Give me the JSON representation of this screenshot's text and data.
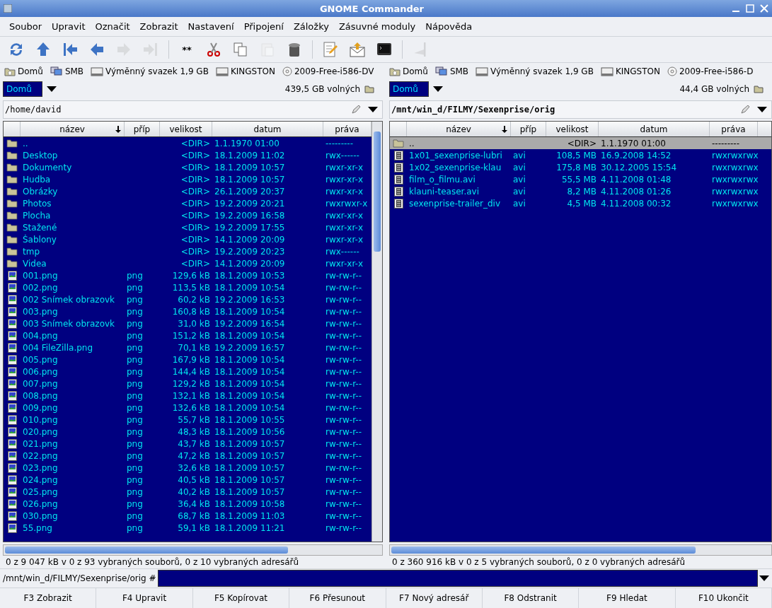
{
  "window": {
    "title": "GNOME Commander"
  },
  "menu": [
    "Soubor",
    "Upravit",
    "Označit",
    "Zobrazit",
    "Nastavení",
    "Připojení",
    "Záložky",
    "Zásuvné moduly",
    "Nápověda"
  ],
  "toolbar": [
    {
      "kind": "refresh",
      "disabled": false
    },
    {
      "kind": "up",
      "disabled": false
    },
    {
      "kind": "first",
      "disabled": false
    },
    {
      "kind": "back",
      "disabled": false
    },
    {
      "kind": "forward",
      "disabled": true
    },
    {
      "kind": "last",
      "disabled": true
    },
    {
      "kind": "separator"
    },
    {
      "kind": "pattern",
      "label": "**",
      "disabled": false
    },
    {
      "kind": "cut",
      "disabled": false
    },
    {
      "kind": "copy",
      "disabled": false
    },
    {
      "kind": "paste",
      "disabled": true
    },
    {
      "kind": "trash",
      "disabled": false
    },
    {
      "kind": "separator"
    },
    {
      "kind": "edit",
      "disabled": false
    },
    {
      "kind": "mail",
      "disabled": false
    },
    {
      "kind": "terminal",
      "disabled": false
    },
    {
      "kind": "separator"
    },
    {
      "kind": "disconnect",
      "disabled": true
    }
  ],
  "panels": [
    {
      "active": false,
      "devices": [
        {
          "kind": "home",
          "label": "Domů"
        },
        {
          "kind": "network",
          "label": "SMB"
        },
        {
          "kind": "drive",
          "label": "Výměnný svazek 1,9 GB"
        },
        {
          "kind": "drive",
          "label": "KINGSTON"
        },
        {
          "kind": "disc",
          "label": "2009-Free-i586-DV"
        }
      ],
      "device_combo": "Domů",
      "free_space": "439,5 GB volných",
      "path": "/home/david",
      "columns": [
        "název",
        "příp",
        "velikost",
        "datum",
        "práva"
      ],
      "rows": [
        {
          "kind": "folder",
          "selected": false,
          "name": "..",
          "ext": "",
          "size": "<DIR>",
          "date": "1.1.1970 01:00",
          "perms": "---------"
        },
        {
          "kind": "folder",
          "selected": false,
          "name": "Desktop",
          "ext": "",
          "size": "<DIR>",
          "date": "18.1.2009 11:02",
          "perms": "rwx------"
        },
        {
          "kind": "folder",
          "selected": false,
          "name": "Dokumenty",
          "ext": "",
          "size": "<DIR>",
          "date": "18.1.2009 10:57",
          "perms": "rwxr-xr-x"
        },
        {
          "kind": "folder",
          "selected": false,
          "name": "Hudba",
          "ext": "",
          "size": "<DIR>",
          "date": "18.1.2009 10:57",
          "perms": "rwxr-xr-x"
        },
        {
          "kind": "folder",
          "selected": false,
          "name": "Obrázky",
          "ext": "",
          "size": "<DIR>",
          "date": "26.1.2009 20:37",
          "perms": "rwxr-xr-x"
        },
        {
          "kind": "folder",
          "selected": false,
          "name": "Photos",
          "ext": "",
          "size": "<DIR>",
          "date": "19.2.2009 20:21",
          "perms": "rwxrwxr-x"
        },
        {
          "kind": "folder",
          "selected": false,
          "name": "Plocha",
          "ext": "",
          "size": "<DIR>",
          "date": "19.2.2009 16:58",
          "perms": "rwxr-xr-x"
        },
        {
          "kind": "folder",
          "selected": false,
          "name": "Stažené",
          "ext": "",
          "size": "<DIR>",
          "date": "19.2.2009 17:55",
          "perms": "rwxr-xr-x"
        },
        {
          "kind": "folder",
          "selected": false,
          "name": "Šablony",
          "ext": "",
          "size": "<DIR>",
          "date": "14.1.2009 20:09",
          "perms": "rwxr-xr-x"
        },
        {
          "kind": "folder",
          "selected": false,
          "name": "tmp",
          "ext": "",
          "size": "<DIR>",
          "date": "19.2.2009 20:23",
          "perms": "rwx------"
        },
        {
          "kind": "folder",
          "selected": false,
          "name": "Videa",
          "ext": "",
          "size": "<DIR>",
          "date": "14.1.2009 20:09",
          "perms": "rwxr-xr-x"
        },
        {
          "kind": "image",
          "selected": false,
          "name": "001.png",
          "ext": "png",
          "size": "129,6 kB",
          "date": "18.1.2009 10:53",
          "perms": "rw-rw-r--"
        },
        {
          "kind": "image",
          "selected": false,
          "name": "002.png",
          "ext": "png",
          "size": "113,5 kB",
          "date": "18.1.2009 10:54",
          "perms": "rw-rw-r--"
        },
        {
          "kind": "image",
          "selected": false,
          "name": "002 Snímek obrazovk",
          "ext": "png",
          "size": "60,2 kB",
          "date": "19.2.2009 16:53",
          "perms": "rw-rw-r--"
        },
        {
          "kind": "image",
          "selected": false,
          "name": "003.png",
          "ext": "png",
          "size": "160,8 kB",
          "date": "18.1.2009 10:54",
          "perms": "rw-rw-r--"
        },
        {
          "kind": "image",
          "selected": false,
          "name": "003 Snímek obrazovk",
          "ext": "png",
          "size": "31,0 kB",
          "date": "19.2.2009 16:54",
          "perms": "rw-rw-r--"
        },
        {
          "kind": "image",
          "selected": false,
          "name": "004.png",
          "ext": "png",
          "size": "151,2 kB",
          "date": "18.1.2009 10:54",
          "perms": "rw-rw-r--"
        },
        {
          "kind": "image",
          "selected": false,
          "name": "004 FileZilla.png",
          "ext": "png",
          "size": "70,1 kB",
          "date": "19.2.2009 16:57",
          "perms": "rw-rw-r--"
        },
        {
          "kind": "image",
          "selected": false,
          "name": "005.png",
          "ext": "png",
          "size": "167,9 kB",
          "date": "18.1.2009 10:54",
          "perms": "rw-rw-r--"
        },
        {
          "kind": "image",
          "selected": false,
          "name": "006.png",
          "ext": "png",
          "size": "144,4 kB",
          "date": "18.1.2009 10:54",
          "perms": "rw-rw-r--"
        },
        {
          "kind": "image",
          "selected": false,
          "name": "007.png",
          "ext": "png",
          "size": "129,2 kB",
          "date": "18.1.2009 10:54",
          "perms": "rw-rw-r--"
        },
        {
          "kind": "image",
          "selected": false,
          "name": "008.png",
          "ext": "png",
          "size": "132,1 kB",
          "date": "18.1.2009 10:54",
          "perms": "rw-rw-r--"
        },
        {
          "kind": "image",
          "selected": false,
          "name": "009.png",
          "ext": "png",
          "size": "132,6 kB",
          "date": "18.1.2009 10:54",
          "perms": "rw-rw-r--"
        },
        {
          "kind": "image",
          "selected": false,
          "name": "010.png",
          "ext": "png",
          "size": "55,7 kB",
          "date": "18.1.2009 10:55",
          "perms": "rw-rw-r--"
        },
        {
          "kind": "image",
          "selected": false,
          "name": "020.png",
          "ext": "png",
          "size": "48,3 kB",
          "date": "18.1.2009 10:56",
          "perms": "rw-rw-r--"
        },
        {
          "kind": "image",
          "selected": false,
          "name": "021.png",
          "ext": "png",
          "size": "43,7 kB",
          "date": "18.1.2009 10:57",
          "perms": "rw-rw-r--"
        },
        {
          "kind": "image",
          "selected": false,
          "name": "022.png",
          "ext": "png",
          "size": "47,2 kB",
          "date": "18.1.2009 10:57",
          "perms": "rw-rw-r--"
        },
        {
          "kind": "image",
          "selected": false,
          "name": "023.png",
          "ext": "png",
          "size": "32,6 kB",
          "date": "18.1.2009 10:57",
          "perms": "rw-rw-r--"
        },
        {
          "kind": "image",
          "selected": false,
          "name": "024.png",
          "ext": "png",
          "size": "40,5 kB",
          "date": "18.1.2009 10:57",
          "perms": "rw-rw-r--"
        },
        {
          "kind": "image",
          "selected": false,
          "name": "025.png",
          "ext": "png",
          "size": "40,2 kB",
          "date": "18.1.2009 10:57",
          "perms": "rw-rw-r--"
        },
        {
          "kind": "image",
          "selected": false,
          "name": "026.png",
          "ext": "png",
          "size": "36,4 kB",
          "date": "18.1.2009 10:58",
          "perms": "rw-rw-r--"
        },
        {
          "kind": "image",
          "selected": false,
          "name": "030.png",
          "ext": "png",
          "size": "68,7 kB",
          "date": "18.1.2009 11:03",
          "perms": "rw-rw-r--"
        },
        {
          "kind": "image",
          "selected": false,
          "name": "55.png",
          "ext": "png",
          "size": "59,1 kB",
          "date": "18.1.2009 11:21",
          "perms": "rw-rw-r--"
        }
      ],
      "status": "0  z 9 047  kB v 0 z 93 vybraných souborů, 0 z 10 vybraných adresářů"
    },
    {
      "active": true,
      "devices": [
        {
          "kind": "home",
          "label": "Domů"
        },
        {
          "kind": "network",
          "label": "SMB"
        },
        {
          "kind": "drive",
          "label": "Výměnný svazek 1,9 GB"
        },
        {
          "kind": "drive",
          "label": "KINGSTON"
        },
        {
          "kind": "disc",
          "label": "2009-Free-i586-D"
        }
      ],
      "device_combo": "Domů",
      "free_space": "44,4 GB volných",
      "path": "/mnt/win_d/FILMY/Sexenprise/orig",
      "columns": [
        "název",
        "příp",
        "velikost",
        "datum",
        "práva"
      ],
      "rows": [
        {
          "kind": "folder",
          "selected": true,
          "name": "..",
          "ext": "",
          "size": "<DIR>",
          "date": "1.1.1970 01:00",
          "perms": "---------"
        },
        {
          "kind": "video",
          "selected": false,
          "name": "1x01_sexenprise-lubri",
          "ext": "avi",
          "size": "108,5 MB",
          "date": "16.9.2008 14:52",
          "perms": "rwxrwxrwx"
        },
        {
          "kind": "video",
          "selected": false,
          "name": "1x02_sexenprise-klau",
          "ext": "avi",
          "size": "175,8 MB",
          "date": "30.12.2005 15:54",
          "perms": "rwxrwxrwx"
        },
        {
          "kind": "video",
          "selected": false,
          "name": "film_o_filmu.avi",
          "ext": "avi",
          "size": "55,5 MB",
          "date": "4.11.2008 01:48",
          "perms": "rwxrwxrwx"
        },
        {
          "kind": "video",
          "selected": false,
          "name": "klauni-teaser.avi",
          "ext": "avi",
          "size": "8,2 MB",
          "date": "4.11.2008 01:26",
          "perms": "rwxrwxrwx"
        },
        {
          "kind": "video",
          "selected": false,
          "name": "sexenprise-trailer_div",
          "ext": "avi",
          "size": "4,5 MB",
          "date": "4.11.2008 00:32",
          "perms": "rwxrwxrwx"
        }
      ],
      "status": "0  z 360 916  kB v 0 z 5 vybraných souborů, 0 z 0 vybraných adresářů"
    }
  ],
  "command_line": {
    "prompt": "/mnt/win_d/FILMY/Sexenprise/orig #"
  },
  "function_keys": [
    "F3 Zobrazit",
    "F4 Upravit",
    "F5 Kopírovat",
    "F6 Přesunout",
    "F7 Nový adresář",
    "F8 Odstranit",
    "F9 Hledat",
    "F10 Ukončit"
  ]
}
